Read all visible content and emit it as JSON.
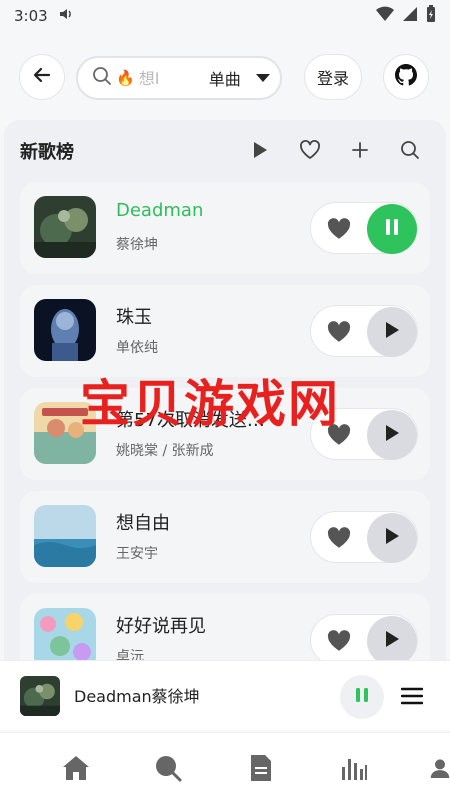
{
  "status_bar": {
    "time": "3:03"
  },
  "top_bar": {
    "search_placeholder": "想Ⅰ",
    "search_emoji": "🔥",
    "search_type": "单曲",
    "login_label": "登录"
  },
  "panel": {
    "title": "新歌榜"
  },
  "songs": [
    {
      "title": "Deadman",
      "artist": "蔡徐坤",
      "playing": true
    },
    {
      "title": "珠玉",
      "artist": "单依纯",
      "playing": false
    },
    {
      "title": "第57次取消发送…",
      "artist": "姚晓棠 / 张新成",
      "playing": false
    },
    {
      "title": "想自由",
      "artist": "王安宇",
      "playing": false
    },
    {
      "title": "好好说再见",
      "artist": "卓沅",
      "playing": false
    }
  ],
  "watermark": "宝贝游戏网",
  "mini_player": {
    "title": "Deadman蔡徐坤"
  },
  "colors": {
    "accent": "#2fc35d",
    "watermark": "#e8201e"
  }
}
